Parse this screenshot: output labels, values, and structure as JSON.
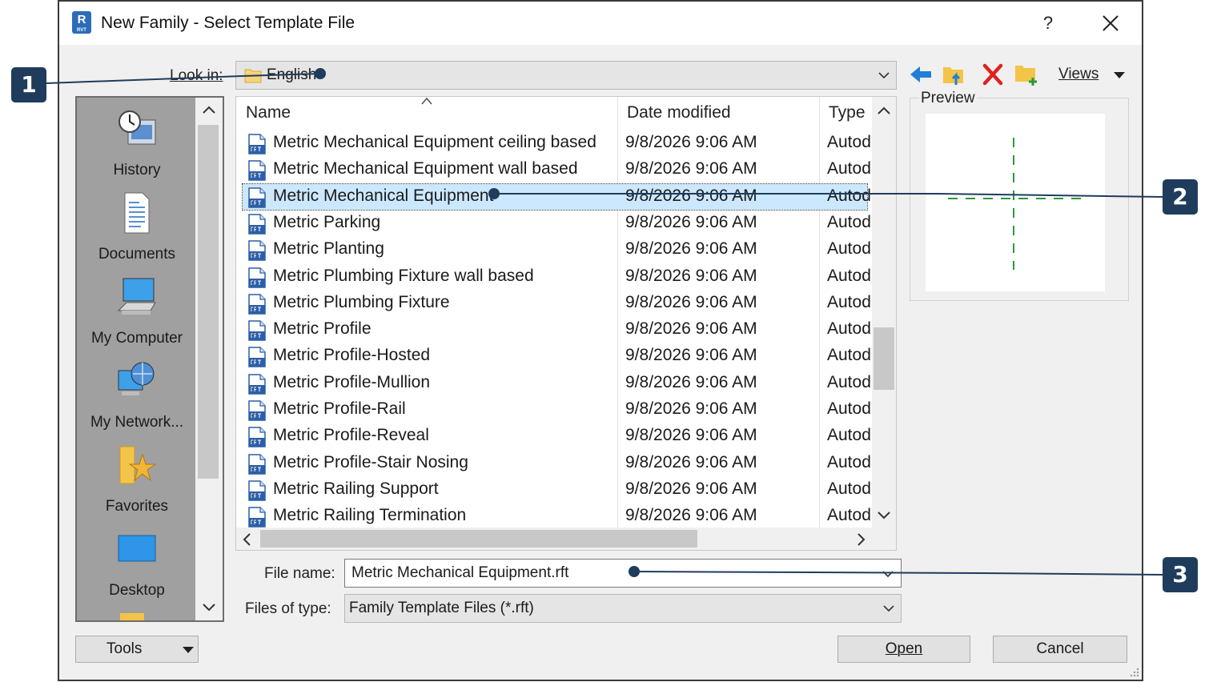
{
  "window": {
    "title": "New Family - Select Template File",
    "help_label": "?",
    "app_icon_letter": "R",
    "app_icon_sub": "RVT"
  },
  "toolbar": {
    "look_in_label": "Look in:",
    "look_in_value": "English",
    "views_label": "Views",
    "icons": [
      "back-arrow-icon",
      "up-folder-icon",
      "delete-icon",
      "new-folder-icon"
    ]
  },
  "places": [
    {
      "label": "History",
      "icon": "history-icon"
    },
    {
      "label": "Documents",
      "icon": "documents-icon"
    },
    {
      "label": "My Computer",
      "icon": "computer-icon"
    },
    {
      "label": "My Network...",
      "icon": "network-icon"
    },
    {
      "label": "Favorites",
      "icon": "favorites-icon"
    },
    {
      "label": "Desktop",
      "icon": "desktop-icon"
    }
  ],
  "file_list": {
    "columns": [
      "Name",
      "Date modified",
      "Type"
    ],
    "rows": [
      {
        "name": "Metric Mechanical Equipment ceiling based",
        "date": "9/8/2026 9:06 AM",
        "type": "Autod"
      },
      {
        "name": "Metric Mechanical Equipment wall based",
        "date": "9/8/2026 9:06 AM",
        "type": "Autod"
      },
      {
        "name": "Metric Mechanical Equipment",
        "date": "9/8/2026 9:06 AM",
        "type": "Autod",
        "selected": true
      },
      {
        "name": "Metric Parking",
        "date": "9/8/2026 9:06 AM",
        "type": "Autod"
      },
      {
        "name": "Metric Planting",
        "date": "9/8/2026 9:06 AM",
        "type": "Autod"
      },
      {
        "name": "Metric Plumbing Fixture wall based",
        "date": "9/8/2026 9:06 AM",
        "type": "Autod"
      },
      {
        "name": "Metric Plumbing Fixture",
        "date": "9/8/2026 9:06 AM",
        "type": "Autod"
      },
      {
        "name": "Metric Profile",
        "date": "9/8/2026 9:06 AM",
        "type": "Autod"
      },
      {
        "name": "Metric Profile-Hosted",
        "date": "9/8/2026 9:06 AM",
        "type": "Autod"
      },
      {
        "name": "Metric Profile-Mullion",
        "date": "9/8/2026 9:06 AM",
        "type": "Autod"
      },
      {
        "name": "Metric Profile-Rail",
        "date": "9/8/2026 9:06 AM",
        "type": "Autod"
      },
      {
        "name": "Metric Profile-Reveal",
        "date": "9/8/2026 9:06 AM",
        "type": "Autod"
      },
      {
        "name": "Metric Profile-Stair Nosing",
        "date": "9/8/2026 9:06 AM",
        "type": "Autod"
      },
      {
        "name": "Metric Railing Support",
        "date": "9/8/2026 9:06 AM",
        "type": "Autod"
      },
      {
        "name": "Metric Railing Termination",
        "date": "9/8/2026 9:06 AM",
        "type": "Autod"
      }
    ]
  },
  "preview": {
    "label": "Preview"
  },
  "form": {
    "file_name_label": "File name:",
    "file_name_value": "Metric Mechanical Equipment.rft",
    "files_of_type_label": "Files of type:",
    "files_of_type_value": "Family Template Files (*.rft)"
  },
  "buttons": {
    "tools": "Tools",
    "open": "Open",
    "cancel": "Cancel"
  },
  "callouts": [
    "1",
    "2",
    "3"
  ],
  "colors": {
    "callout": "#1f3c5c",
    "selection": "#cce8ff",
    "preview_line": "#2a9a3a",
    "accent_blue": "#1f7fd8",
    "delete_red": "#e02020",
    "folder_yellow": "#f3c447"
  }
}
